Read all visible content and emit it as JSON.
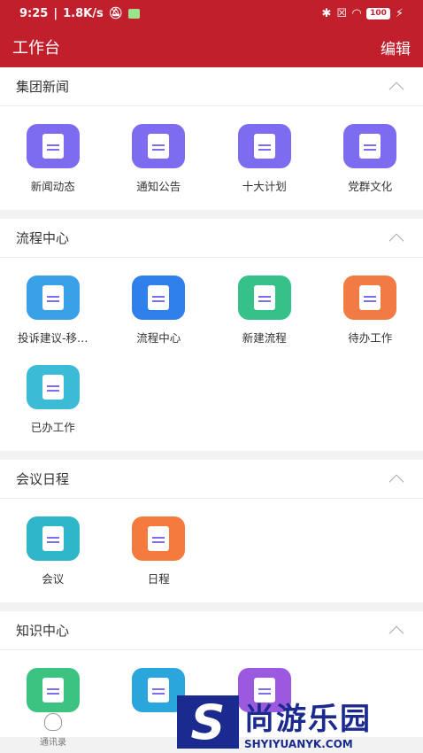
{
  "status_bar": {
    "time": "9:25",
    "speed": "1.8K/s",
    "battery": "100"
  },
  "header": {
    "title": "工作台",
    "edit": "编辑"
  },
  "sections": [
    {
      "title": "集团新闻",
      "items": [
        {
          "label": "新闻动态",
          "icon": "document-icon",
          "color": "#7e6cf0"
        },
        {
          "label": "通知公告",
          "icon": "document-icon",
          "color": "#7e6cf0"
        },
        {
          "label": "十大计划",
          "icon": "document-icon",
          "color": "#7e6cf0"
        },
        {
          "label": "党群文化",
          "icon": "document-icon",
          "color": "#7e6cf0"
        }
      ]
    },
    {
      "title": "流程中心",
      "items": [
        {
          "label": "投诉建议-移…",
          "icon": "form-icon",
          "color": "#3aa0e8"
        },
        {
          "label": "流程中心",
          "icon": "stack-icon",
          "color": "#2f80ea"
        },
        {
          "label": "新建流程",
          "icon": "new-flow-icon",
          "color": "#36c08a"
        },
        {
          "label": "待办工作",
          "icon": "pending-icon",
          "color": "#f17a45"
        },
        {
          "label": "已办工作",
          "icon": "done-icon",
          "color": "#3bbbd6"
        }
      ]
    },
    {
      "title": "会议日程",
      "items": [
        {
          "label": "会议",
          "icon": "meeting-icon",
          "color": "#2fb7c9"
        },
        {
          "label": "日程",
          "icon": "calendar-icon",
          "color": "#f47a3d"
        }
      ]
    },
    {
      "title": "知识中心",
      "items": [
        {
          "label": "",
          "icon": "kit-icon",
          "color": "#3cc382"
        },
        {
          "label": "",
          "icon": "cloud-drive-icon",
          "color": "#2aa6dc"
        },
        {
          "label": "",
          "icon": "camera-icon",
          "color": "#9b59e0"
        }
      ]
    }
  ],
  "bottom_nav": {
    "label": "通讯录"
  },
  "watermark": {
    "letter": "S",
    "zh": "尚游乐园",
    "en": "SHYIYUANYK.COM"
  }
}
